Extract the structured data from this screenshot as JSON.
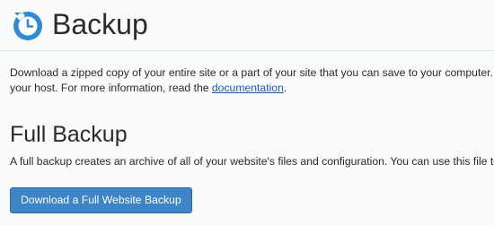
{
  "header": {
    "title": "Backup",
    "icon": "backup-clock-icon",
    "accent_color": "#2f8ad6"
  },
  "intro": {
    "text_before_link": "Download a zipped copy of your entire site or a part of your site that you can save to your computer. W",
    "text_line2": "your host. For more information, read the ",
    "link_label": "documentation",
    "text_after_link": "."
  },
  "full_backup": {
    "title": "Full Backup",
    "description": "A full backup creates an archive of all of your website's files and configuration. You can use this file to",
    "button_label": "Download a Full Website Backup",
    "button_color": "#3d85c8"
  }
}
